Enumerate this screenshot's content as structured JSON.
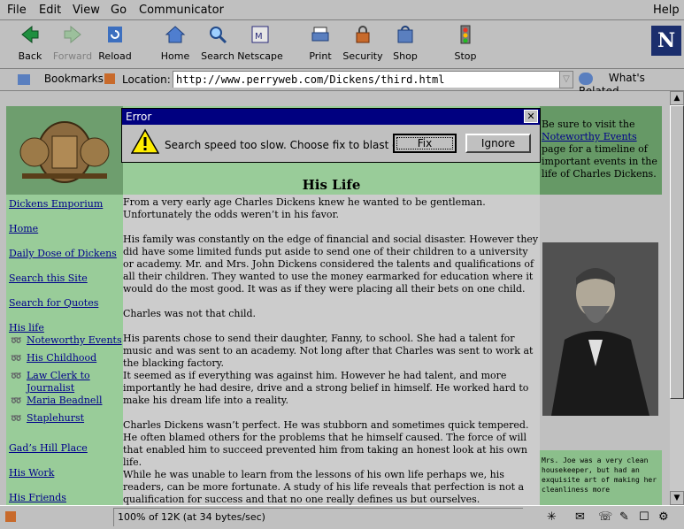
{
  "menubar": {
    "file": "File",
    "edit": "Edit",
    "view": "View",
    "go": "Go",
    "communicator": "Communicator",
    "help": "Help"
  },
  "toolbar": {
    "back": "Back",
    "forward": "Forward",
    "reload": "Reload",
    "home": "Home",
    "search": "Search",
    "netscape": "Netscape",
    "print": "Print",
    "security": "Security",
    "shop": "Shop",
    "stop": "Stop"
  },
  "location": {
    "bookmarks": "Bookmarks",
    "label": "Location:",
    "url": "http://www.perryweb.com/Dickens/third.html",
    "whats_related": "What's Related"
  },
  "page": {
    "title": "His Life",
    "nav": [
      "Dickens Emporium",
      "Home",
      "Daily Dose of Dickens",
      "Search this Site",
      "Search for Quotes",
      "His life",
      "Noteworthy Events",
      "His Childhood",
      "Law Clerk to",
      "Journalist",
      "Maria Beadnell",
      "Staplehurst",
      "Gad’s Hill Place",
      "His Work",
      "His Friends"
    ],
    "right_top": {
      "pre": "Be sure to visit the ",
      "link": "Noteworthy Events",
      "post": " page for a timeline of important events in the life of Charles Dickens."
    },
    "right_bottom": "Mrs. Joe was a very clean housekeeper, but had an exquisite art of making her cleanliness more",
    "paras": [
      "From a very early age Charles Dickens knew he wanted to be gentleman. Unfortunately the odds weren’t in his favor.",
      "His family was constantly on the edge of financial and social disaster. However they did have some limited funds put aside to send one of their children to a university or academy. Mr. and Mrs. John Dickens considered the talents and qualifications of all their children. They wanted to use the money earmarked for education where it would do the most good. It was as if they were placing all their bets on one child.",
      "Charles was not that child.",
      "His parents chose to send their daughter, Fanny, to school. She had a talent for music and was sent to an academy. Not long after that Charles was sent to work at the blacking factory.",
      "It seemed as if everything was against him. However he had talent, and more importantly he had desire, drive and a strong belief in himself. He worked hard to make his dream life into a reality.",
      "Charles Dickens wasn’t perfect. He was stubborn and sometimes quick tempered. He often blamed others for the problems that he himself caused. The force of will that enabled him to succeed prevented him from taking an honest look at his own life.",
      "While he was unable to learn from the lessons of his own life perhaps we, his readers, can be more fortunate. A study of his life reveals that perfection is not a qualification for success and that no one really defines us but ourselves."
    ]
  },
  "dialog": {
    "title": "Error",
    "message": "Search speed too slow.  Choose fix to blast off.",
    "fix": "Fix",
    "ignore": "Ignore"
  },
  "status": {
    "text": "100% of 12K (at 34 bytes/sec)"
  }
}
